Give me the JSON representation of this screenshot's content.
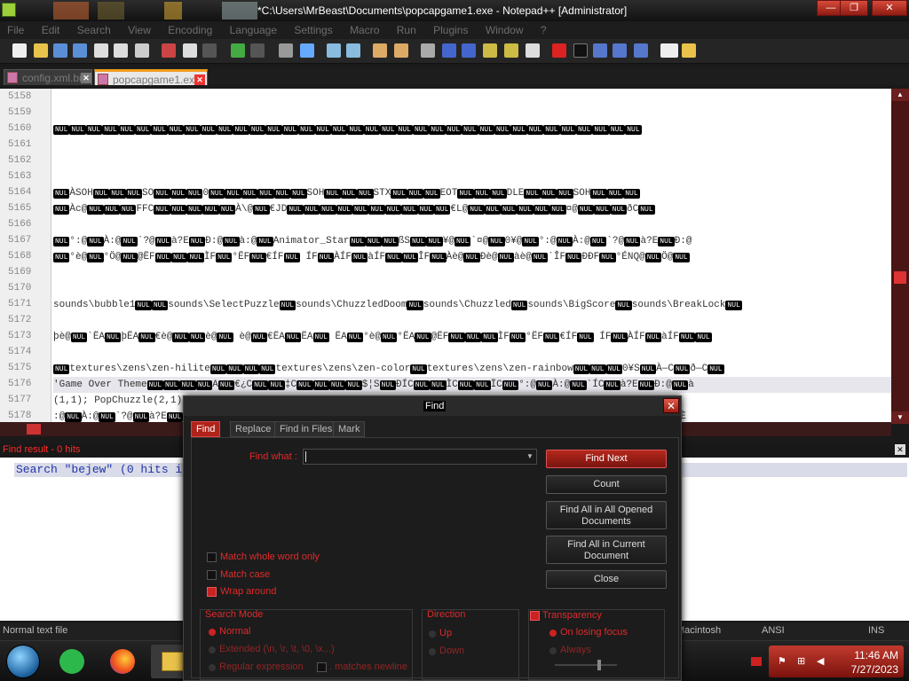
{
  "window": {
    "title": "*C:\\Users\\MrBeast\\Documents\\popcapgame1.exe - Notepad++ [Administrator]",
    "min_symbol": "—",
    "restore_symbol": "❐",
    "close_symbol": "✕"
  },
  "menu": [
    "File",
    "Edit",
    "Search",
    "View",
    "Encoding",
    "Language",
    "Settings",
    "Macro",
    "Run",
    "Plugins",
    "Window",
    "?"
  ],
  "tabs": [
    {
      "label": "config.xml.bin",
      "close": "✕"
    },
    {
      "label": "popcapgame1.exe",
      "close": "✕"
    }
  ],
  "editor": {
    "line_numbers": [
      "5158",
      "5159",
      "5160",
      "5161",
      "5162",
      "5163",
      "5164",
      "5165",
      "5166",
      "5167",
      "5168",
      "5169",
      "5170",
      "5171",
      "5172",
      "5173",
      "5174",
      "5175",
      "5176",
      "5177",
      "5178"
    ],
    "nul_token": "NUL",
    "lines": [
      "",
      "",
      "NUL",
      "",
      "",
      "",
      "NULÀSOHNULNULNULSONULNULNUL0NULNULNULNULNULNULSOHNULNULNULSTXNULNULNULEOTNULNULNULDLENULNULNULSOHNULNULNUL",
      "NULÀc@NULNULNULFFCNULNULNULNULNULÀ\\@NUL€JDNULNULNULNULNULNULNULNULNULNUL€L@NULNULNULNULNULNUL¤@NULNULNULðCNUL",
      "",
      "NUL°:@NULÀ:@NUL`?@NULà?ENULÐ:@NULà:@NULAnimator_StarNULNULNULßSNULNUL¥@NUL`¤@NUL0¥@NUL°:@NULÀ:@NUL`?@NULà?ENULÐ:@",
      "NUL°è@NUL°Ö@NUL@ËFNULNULNULÌFNUL°ËFNUL€ÍFNUL ÍFNULÀÍFNULàÍFNULNULÎFNULÀè@NULÐè@NULàè@NUL`ÎFNULÐÐFNUL°ÉNQ@NULÖ@NUL",
      "",
      "",
      "sounds\\bubble1NULNULsounds\\SelectPuzzleNULsounds\\ChuzzledDoomNULsounds\\ChuzzledNULsounds\\BigScoreNULsounds\\BreakLockNUL",
      "",
      "þè@NUL`ËANULþËANUL€è@NULNULè@NUL è@NUL€ËANULËANUL ËANUL°è@NUL°ËANUL@ËFNULNULNULÌFNUL°ËFNUL€ÍFNUL ÍFNULÀÍFNULàÍFNULNUL",
      "",
      "NULtextures\\zens\\zen-hiliteNULNULNULNULtextures\\zens\\zen-colorNULtextures\\zens\\zen-rainbowNULNULNUL0¥SNULÀ—CNULð—CNUL",
      "'Game Over ThemeNULNULNULNULANUL€¿CNULNUL‡CNULNULNULNUL$¦SNULÐÍCNULNULÌCNULNULÏCNUL°:@NULÀ:@NUL`ÍCNULà?ENULÐ:@NULà",
      "(1,1);          PopChuzzle(2,1);          PopChuzzle(1,0,1);          DropChuzzle(1,-1,0,1);          DropN",
      ":@NULÀ:@NUL`?@NULà?ENULÐ:@NULà:@NUL ÆFNULÀÑFNULPËANULpÇFNUL0ËFNULÐLËFNULNULËFNULÐÆFNUL ÇFNUL ÎFNULÀÍFNULÀÍFNULPÈ"
    ]
  },
  "find_result": {
    "title": "Find result - 0 hits",
    "line": "Search \"bejew\" (0 hits in",
    "close": "✕"
  },
  "status": {
    "type": "Normal text file",
    "eol": "Macintosh",
    "encoding": "ANSI",
    "mode": "INS"
  },
  "clock": {
    "time": "11:46 AM",
    "date": "7/27/2023"
  },
  "dialog": {
    "title": "Find",
    "close": "✕",
    "tabs": [
      "Find",
      "Replace",
      "Find in Files",
      "Mark"
    ],
    "find_what_label": "Find what :",
    "find_what_value": "",
    "buttons": {
      "find_next": "Find Next",
      "count": "Count",
      "find_all_opened": "Find All in All Opened Documents",
      "find_all_current": "Find All in Current Document",
      "close": "Close"
    },
    "options": {
      "match_whole_word": "Match whole word only",
      "match_case": "Match case",
      "wrap_around": "Wrap around"
    },
    "search_mode": {
      "title": "Search Mode",
      "normal": "Normal",
      "extended": "Extended (\\n, \\r, \\t, \\0, \\x...)",
      "regex": "Regular expression",
      "matches_newline": ". matches newline"
    },
    "direction": {
      "title": "Direction",
      "up": "Up",
      "down": "Down"
    },
    "transparency": {
      "title": "Transparency",
      "on_losing_focus": "On losing focus",
      "always": "Always"
    }
  },
  "colors": {
    "accent": "#b0231a",
    "tab_highlight": "#f29b1d",
    "find_result_red": "#ff2a2a"
  }
}
